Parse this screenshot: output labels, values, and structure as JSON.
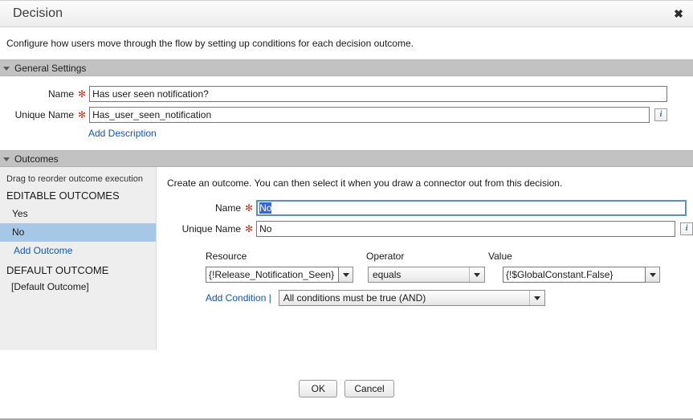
{
  "window": {
    "title": "Decision",
    "close_label": "✖",
    "sliver_text": "§"
  },
  "intro": {
    "text": "Configure how users move through the flow by setting up conditions for each decision outcome."
  },
  "general_settings": {
    "section_title": "General Settings",
    "name": {
      "label": "Name",
      "required_marker": "✻",
      "value": "Has user seen notification?"
    },
    "unique_name": {
      "label": "Unique Name",
      "required_marker": "✻",
      "value": "Has_user_seen_notification",
      "info_icon_label": "i"
    },
    "add_description_label": "Add Description"
  },
  "outcomes": {
    "section_title": "Outcomes",
    "drag_hint": "Drag to reorder outcome execution",
    "editable_group_title": "EDITABLE OUTCOMES",
    "items": [
      {
        "label": "Yes",
        "selected": false
      },
      {
        "label": "No",
        "selected": true
      }
    ],
    "add_outcome_label": "Add Outcome",
    "default_group_title": "DEFAULT OUTCOME",
    "default_outcome_label": "[Default Outcome]"
  },
  "outcome_detail": {
    "intro": "Create an outcome.  You can then select it when you draw a connector out from this decision.",
    "name": {
      "label": "Name",
      "required_marker": "✻",
      "value": "No"
    },
    "unique_name": {
      "label": "Unique Name",
      "required_marker": "✻",
      "value": "No",
      "info_icon_label": "i"
    },
    "condition": {
      "resource_header": "Resource",
      "operator_header": "Operator",
      "value_header": "Value",
      "resource_value": "{!Release_Notification_Seen}",
      "operator_value": "equals",
      "value_value": "{!$GlobalConstant.False}",
      "add_condition_label": "Add Condition |",
      "logic_value": "All conditions must be true (AND)"
    }
  },
  "footer": {
    "ok_label": "OK",
    "cancel_label": "Cancel"
  },
  "colors": {
    "section_bar": "#c2c2c2",
    "selection_blue": "#a7c7e7",
    "link_blue": "#1155aa",
    "required_red": "#c23b22",
    "panel_gray": "#eeeeee",
    "focus_border": "#5a8fc0",
    "text_selection": "#b5d1ef"
  }
}
